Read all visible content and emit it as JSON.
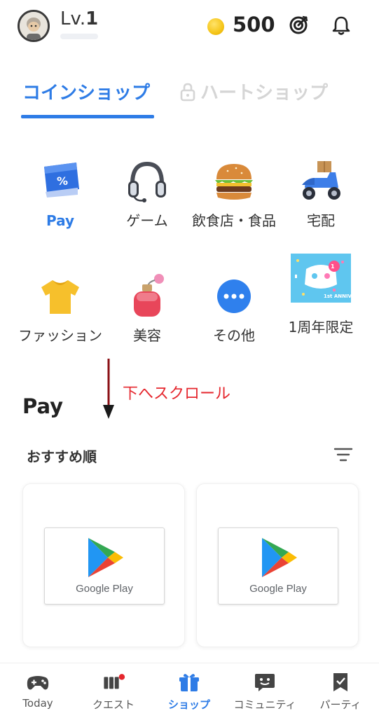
{
  "header": {
    "level_prefix": "Lv.",
    "level_value": "1",
    "coin_count": "500",
    "icons": [
      "avatar",
      "coin-icon",
      "target-icon",
      "bell-icon"
    ]
  },
  "tabs": [
    {
      "label": "コインショップ",
      "active": true
    },
    {
      "label": "ハートショップ",
      "active": false,
      "icon": "lock-icon"
    }
  ],
  "categories": [
    {
      "label": "Pay",
      "icon": "pay-card-icon",
      "active": true
    },
    {
      "label": "ゲーム",
      "icon": "headset-icon"
    },
    {
      "label": "飲食店・食品",
      "icon": "burger-icon"
    },
    {
      "label": "宅配",
      "icon": "delivery-scooter-icon"
    },
    {
      "label": "ファッション",
      "icon": "tshirt-icon"
    },
    {
      "label": "美容",
      "icon": "perfume-icon"
    },
    {
      "label": "その他",
      "icon": "more-icon"
    },
    {
      "label": "1周年限定",
      "icon": "anniversary-icon",
      "badge": "1st ANNIV."
    }
  ],
  "annotation": {
    "text": "下へスクロール",
    "color": "#e5262d"
  },
  "section": {
    "title": "Pay",
    "sort_label": "おすすめ順"
  },
  "products": [
    {
      "brand": "Google Play"
    },
    {
      "brand": "Google Play"
    }
  ],
  "bottom_nav": [
    {
      "label": "Today",
      "icon": "gamepad-icon"
    },
    {
      "label": "クエスト",
      "icon": "quest-icon",
      "notification_dot": true
    },
    {
      "label": "ショップ",
      "icon": "gift-icon",
      "active": true
    },
    {
      "label": "コミュニティ",
      "icon": "chat-icon"
    },
    {
      "label": "パーティ",
      "icon": "flag-icon"
    }
  ],
  "colors": {
    "accent": "#2e7ce6",
    "inactive_tab": "#d5d5d5",
    "notification": "#e5262d"
  }
}
